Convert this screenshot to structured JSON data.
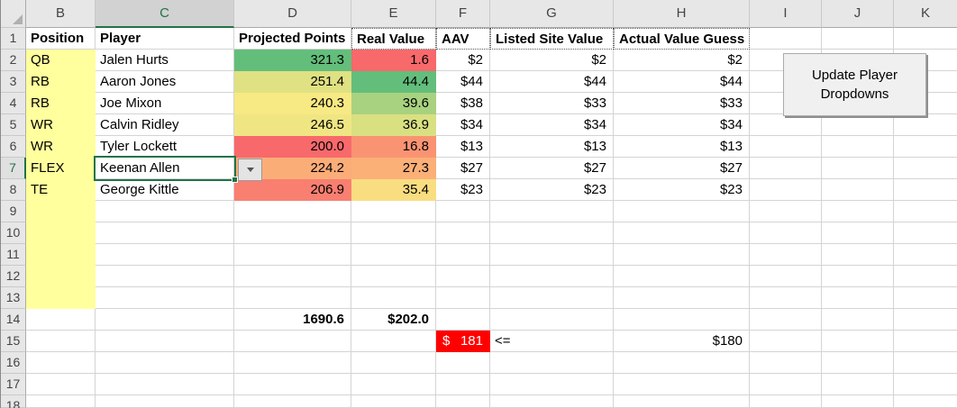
{
  "grid": {
    "column_headers": [
      "B",
      "C",
      "D",
      "E",
      "F",
      "G",
      "H",
      "I",
      "J",
      "K"
    ],
    "row_numbers": [
      "1",
      "2",
      "3",
      "4",
      "5",
      "6",
      "7",
      "8",
      "9",
      "10",
      "11",
      "12",
      "13",
      "14",
      "15",
      "16",
      "17",
      "18"
    ]
  },
  "table": {
    "headers": {
      "position": "Position",
      "player": "Player",
      "projected_points": "Projected Points",
      "real_value": "Real Value",
      "aav": "AAV",
      "listed_site_value": "Listed Site Value",
      "actual_value_guess": "Actual Value Guess"
    }
  },
  "players": [
    {
      "position": "QB",
      "name": "Jalen Hurts",
      "projected_points": "321.3",
      "real_value": "1.6",
      "aav": "$2",
      "listed_site_value": "$2",
      "actual_value_guess": "$2",
      "pp_color": "#63BE7B",
      "rv_color": "#F8696B"
    },
    {
      "position": "RB",
      "name": "Aaron Jones",
      "projected_points": "251.4",
      "real_value": "44.4",
      "aav": "$44",
      "listed_site_value": "$44",
      "actual_value_guess": "$44",
      "pp_color": "#E0E182",
      "rv_color": "#63BE7B"
    },
    {
      "position": "RB",
      "name": "Joe Mixon",
      "projected_points": "240.3",
      "real_value": "39.6",
      "aav": "$38",
      "listed_site_value": "$33",
      "actual_value_guess": "$33",
      "pp_color": "#F7E984",
      "rv_color": "#A8D27F"
    },
    {
      "position": "WR",
      "name": "Calvin Ridley",
      "projected_points": "246.5",
      "real_value": "36.9",
      "aav": "$34",
      "listed_site_value": "$34",
      "actual_value_guess": "$34",
      "pp_color": "#EFE683",
      "rv_color": "#D9E082"
    },
    {
      "position": "WR",
      "name": "Tyler Lockett",
      "projected_points": "200.0",
      "real_value": "16.8",
      "aav": "$13",
      "listed_site_value": "$13",
      "actual_value_guess": "$13",
      "pp_color": "#F8696B",
      "rv_color": "#FA9372"
    },
    {
      "position": "FLEX",
      "name": "Keenan Allen",
      "projected_points": "224.2",
      "real_value": "27.3",
      "aav": "$27",
      "listed_site_value": "$27",
      "actual_value_guess": "$27",
      "pp_color": "#FBAD78",
      "rv_color": "#FBB078"
    },
    {
      "position": "TE",
      "name": "George Kittle",
      "projected_points": "206.9",
      "real_value": "35.4",
      "aav": "$23",
      "listed_site_value": "$23",
      "actual_value_guess": "$23",
      "pp_color": "#F97F71",
      "rv_color": "#F9DD81"
    }
  ],
  "totals": {
    "projected_points_total": "1690.6",
    "real_value_total": "$202.0"
  },
  "budget": {
    "symbol": "$",
    "amount": "181",
    "operator": "<=",
    "cap": "$180"
  },
  "selection": {
    "cell": "C7",
    "value": "Keenan Allen"
  },
  "button": {
    "label": "Update Player Dropdowns"
  },
  "colors": {
    "selection_green": "#217346",
    "yellow_fill": "#FFFF9E",
    "alert_bg": "#FF0000",
    "alert_text": "#FFFFFF",
    "header_bg": "#E7E7E7",
    "selected_header_bg": "#D2D2D2",
    "gridline": "#D4D4D4"
  }
}
